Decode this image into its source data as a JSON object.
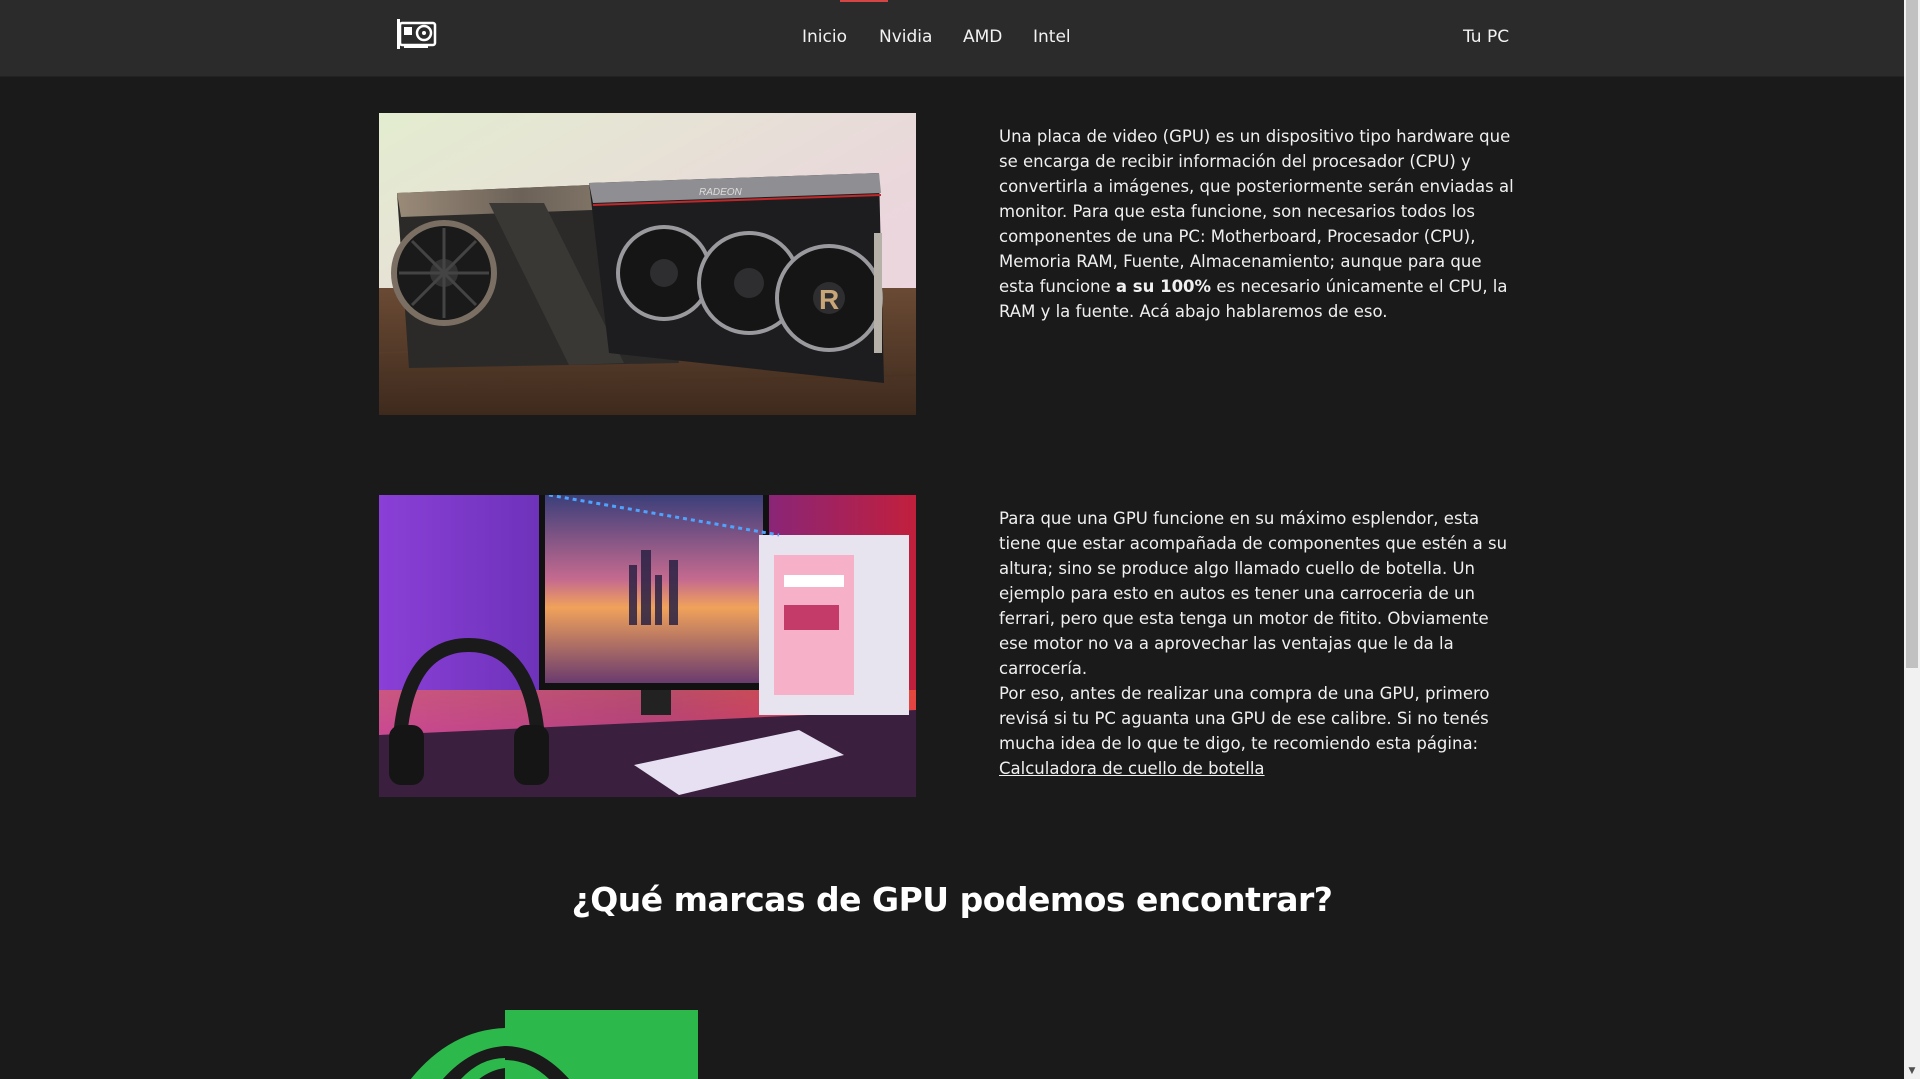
{
  "nav": {
    "items": [
      "Inicio",
      "Nvidia",
      "AMD",
      "Intel"
    ],
    "right": "Tu PC"
  },
  "sections": [
    {
      "image_alt": "Nvidia and AMD Radeon graphics cards",
      "text_before": "Una placa de video (GPU) es un dispositivo tipo hardware que se encarga de recibir información del procesador (CPU) y convertirla a imágenes, que posteriormente serán enviadas al monitor. Para que esta funcione, son necesarios todos los componentes de una PC: Motherboard, Procesador (CPU), Memoria RAM, Fuente, Almacenamiento; aunque para que esta funcione ",
      "text_bold": "a su 100%",
      "text_after": " es necesario únicamente el CPU, la RAM y la fuente. Acá abajo hablaremos de eso."
    },
    {
      "image_alt": "Gaming PC setup with monitor and RGB lighting",
      "text_1": "Para que una GPU funcione en su máximo esplendor, esta tiene que estar acompañada de componentes que estén a su altura; sino se produce algo llamado cuello de botella. Un ejemplo para esto en autos es tener una carroceria de un ferrari, pero que esta tenga un motor de fitito. Obviamente ese motor no va a aprovechar las ventajas que le da la carrocería.",
      "text_2": "Por eso, antes de realizar una compra de una GPU, primero revisá si tu PC aguanta una GPU de ese calibre. Si no tenés mucha idea de lo que te digo, te recomiendo esta página:",
      "link": "Calculadora de cuello de botella"
    }
  ],
  "brands_title": "¿Qué marcas de GPU podemos encontrar?",
  "colors": {
    "header_bg": "#2b2b2b",
    "page_bg": "#1a1a1a",
    "nav_indicator": "#d64545",
    "nvidia_green": "#2db84b"
  }
}
